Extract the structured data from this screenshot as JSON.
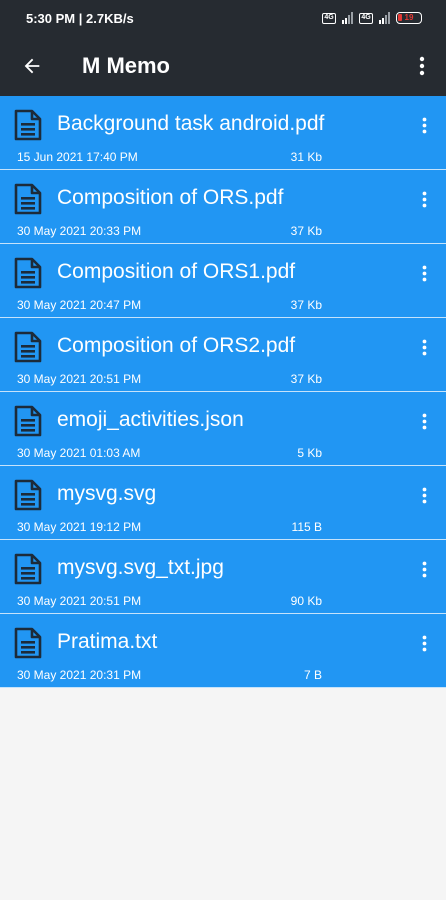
{
  "status_bar": {
    "time": "5:30 PM | 2.7KB/s",
    "sim1_label": "4G",
    "sim2_label": "4G",
    "battery_level": "19"
  },
  "app_bar": {
    "back_icon": "arrow-left-icon",
    "title": "M Memo",
    "overflow_icon": "more-vert-icon"
  },
  "colors": {
    "app_bar": "#262b31",
    "item_background": "#2196f3",
    "item_divider": "#c5e3fb",
    "page_background": "#f5f5f5",
    "icon_color": "#1c2b3a"
  },
  "files": [
    {
      "name": "Background task android.pdf",
      "date": "15 Jun 2021 17:40 PM",
      "size": "31 Kb"
    },
    {
      "name": "Composition of ORS.pdf",
      "date": "30 May 2021 20:33 PM",
      "size": "37 Kb"
    },
    {
      "name": "Composition of ORS1.pdf",
      "date": "30 May 2021 20:47 PM",
      "size": "37 Kb"
    },
    {
      "name": "Composition of ORS2.pdf",
      "date": "30 May 2021 20:51 PM",
      "size": "37 Kb"
    },
    {
      "name": "emoji_activities.json",
      "date": "30 May 2021 01:03 AM",
      "size": "5 Kb"
    },
    {
      "name": "mysvg.svg",
      "date": "30 May 2021 19:12 PM",
      "size": "115 B"
    },
    {
      "name": "mysvg.svg_txt.jpg",
      "date": "30 May 2021 20:51 PM",
      "size": "90 Kb"
    },
    {
      "name": "Pratima.txt",
      "date": "30 May 2021 20:31 PM",
      "size": "7 B"
    }
  ]
}
